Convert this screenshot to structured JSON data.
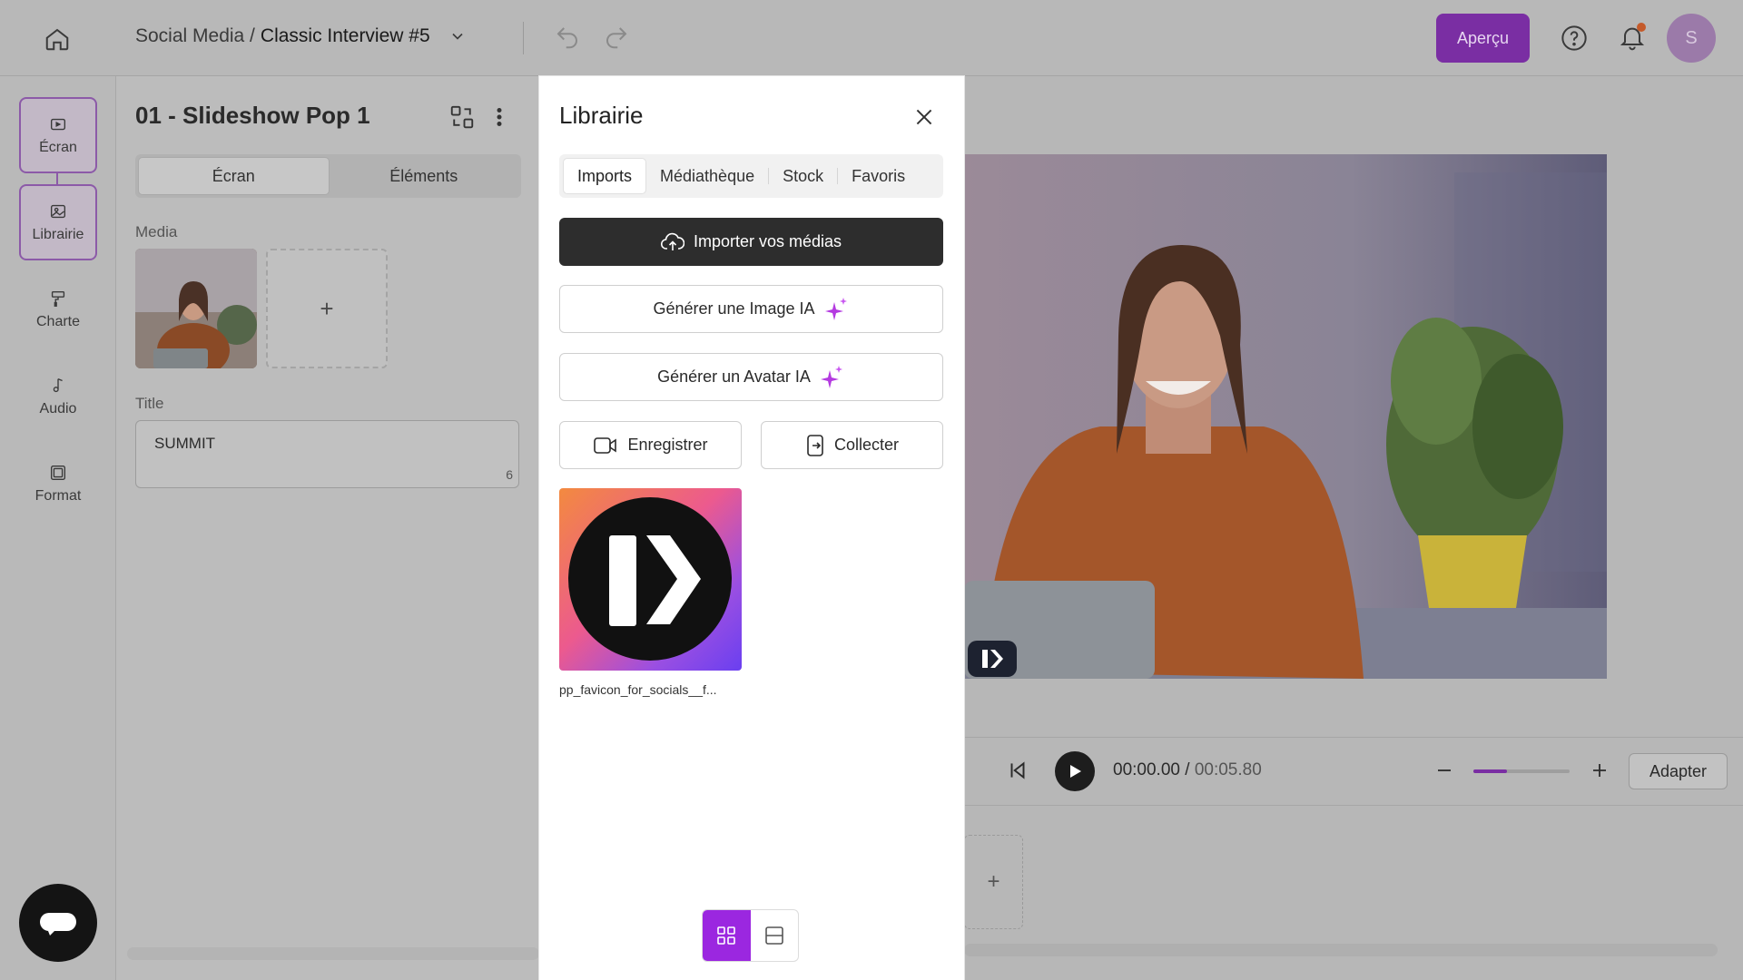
{
  "topbar": {
    "breadcrumb_prefix": "Social Media /",
    "breadcrumb_title": "Classic Interview #5",
    "apercu_label": "Aperçu",
    "avatar_initial": "S",
    "accent_color": "#9b27e0"
  },
  "rail": {
    "items": [
      {
        "label": "Écran",
        "icon": "screen-icon"
      },
      {
        "label": "Librairie",
        "icon": "library-icon"
      },
      {
        "label": "Charte",
        "icon": "paint-roller-icon"
      },
      {
        "label": "Audio",
        "icon": "music-note-icon"
      },
      {
        "label": "Format",
        "icon": "crop-icon"
      }
    ]
  },
  "editor": {
    "title": "01 - Slideshow Pop 1",
    "tabs": [
      "Écran",
      "Éléments"
    ],
    "active_tab": "Écran",
    "media_label": "Media",
    "add_symbol": "+",
    "title_label": "Title",
    "title_value": "SUMMIT",
    "title_count": "6"
  },
  "library": {
    "title": "Librairie",
    "tabs": [
      "Imports",
      "Médiathèque",
      "Stock",
      "Favoris"
    ],
    "active_tab": "Imports",
    "import_label": "Importer vos médias",
    "gen_image_label": "Générer une Image IA",
    "gen_avatar_label": "Générer un Avatar IA",
    "record_label": "Enregistrer",
    "collect_label": "Collecter",
    "assets": [
      {
        "name": "pp_favicon_for_socials__f..."
      }
    ],
    "view_modes": [
      "grid",
      "list"
    ],
    "active_view": "grid"
  },
  "player": {
    "current_time": "00:00.00",
    "separator": "/",
    "total_time": "00:05.80",
    "zoom_fraction": 0.35,
    "adapter_label": "Adapter",
    "add_symbol": "+"
  }
}
